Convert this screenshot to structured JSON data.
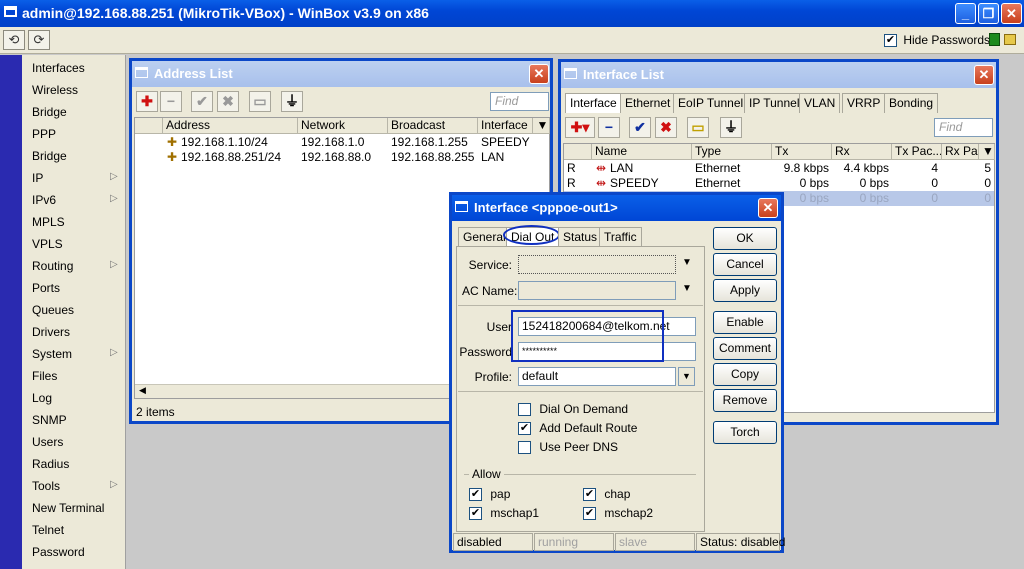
{
  "window": {
    "title": "admin@192.168.88.251 (MikroTik-VBox) - WinBox v3.9 on x86"
  },
  "toolbar": {
    "undo": "⟲",
    "redo": "⟳",
    "hide_passwords_label": "Hide Passwords",
    "hide_passwords_checked": true
  },
  "menu": [
    "Interfaces",
    "Wireless",
    "Bridge",
    "PPP",
    "Bridge",
    "IP",
    "IPv6",
    "MPLS",
    "VPLS",
    "Routing",
    "Ports",
    "Queues",
    "Drivers",
    "System",
    "Files",
    "Log",
    "SNMP",
    "Users",
    "Radius",
    "Tools",
    "New Terminal",
    "Telnet",
    "Password"
  ],
  "menu_arrows": [
    "IP",
    "IPv6",
    "Routing",
    "System",
    "Tools"
  ],
  "address_list": {
    "title": "Address List",
    "find_placeholder": "Find",
    "columns": [
      "Address",
      "Network",
      "Broadcast",
      "Interface"
    ],
    "rows": [
      [
        "192.168.1.10/24",
        "192.168.1.0",
        "192.168.1.255",
        "SPEEDY"
      ],
      [
        "192.168.88.251/24",
        "192.168.88.0",
        "192.168.88.255",
        "LAN"
      ]
    ],
    "status": "2 items"
  },
  "interface_list": {
    "title": "Interface List",
    "tabs": [
      "Interface",
      "Ethernet",
      "EoIP Tunnel",
      "IP Tunnel",
      "VLAN",
      "VRRP",
      "Bonding"
    ],
    "find_placeholder": "Find",
    "columns": [
      "Name",
      "Type",
      "Tx",
      "Rx",
      "Tx Pac...",
      "Rx Pac"
    ],
    "rows": [
      {
        "flag": "R",
        "name": "LAN",
        "type": "Ethernet",
        "tx": "9.8 kbps",
        "rx": "4.4 kbps",
        "txp": "4",
        "rxp": "5"
      },
      {
        "flag": "R",
        "name": "SPEEDY",
        "type": "Ethernet",
        "tx": "0 bps",
        "rx": "0 bps",
        "txp": "0",
        "rxp": "0"
      },
      {
        "flag": "",
        "name": "",
        "type": "",
        "tx": "0 bps",
        "rx": "0 bps",
        "txp": "0",
        "rxp": "0"
      }
    ]
  },
  "dialog": {
    "title": "Interface <pppoe-out1>",
    "tabs": [
      "General",
      "Dial Out",
      "Status",
      "Traffic"
    ],
    "service_label": "Service:",
    "service_value": "",
    "ac_name_label": "AC Name:",
    "ac_name_value": "",
    "user_label": "User",
    "user_value": "152418200684@telkom.net",
    "password_label": "Password",
    "password_value": "**********",
    "profile_label": "Profile:",
    "profile_value": "default",
    "dial_on_demand": {
      "label": "Dial On Demand",
      "checked": false
    },
    "add_default_route": {
      "label": "Add Default Route",
      "checked": true
    },
    "use_peer_dns": {
      "label": "Use Peer DNS",
      "checked": false
    },
    "allow_label": "Allow",
    "allow": [
      {
        "label": "pap",
        "checked": true
      },
      {
        "label": "chap",
        "checked": true
      },
      {
        "label": "mschap1",
        "checked": true
      },
      {
        "label": "mschap2",
        "checked": true
      }
    ],
    "buttons": [
      "OK",
      "Cancel",
      "Apply",
      "Enable",
      "Comment",
      "Copy",
      "Remove",
      "Torch"
    ],
    "status": [
      "disabled",
      "running",
      "slave",
      "Status: disabled"
    ]
  },
  "colors": {
    "titlebar": "#0046d5",
    "highlight": "#1030c0",
    "sidebar_strip": "#2a2ab0"
  }
}
